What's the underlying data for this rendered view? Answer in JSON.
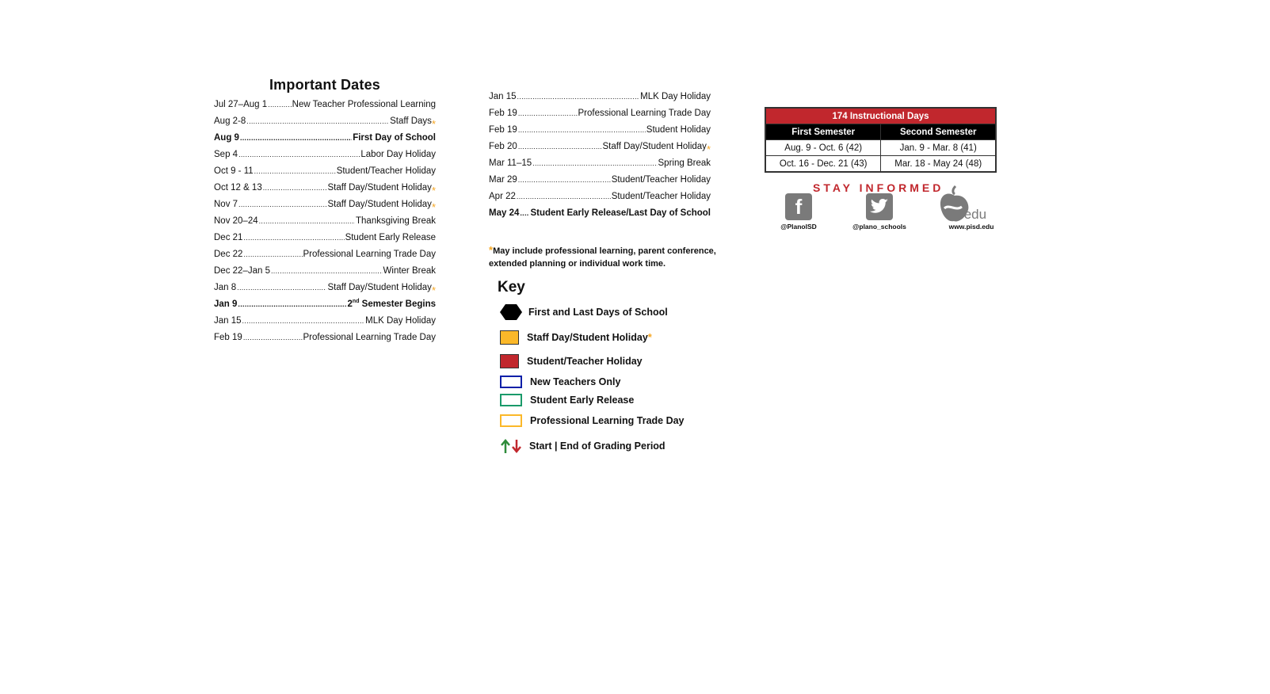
{
  "important_dates": {
    "title": "Important Dates",
    "col1": [
      {
        "date": "Jul 27–Aug 1",
        "event": "New Teacher Professional Learning",
        "bold": false,
        "asterisk": false
      },
      {
        "date": "Aug 2-8",
        "event": "Staff Days",
        "bold": false,
        "asterisk": true
      },
      {
        "date": "Aug 9",
        "event": "First Day of School",
        "bold": true,
        "asterisk": false
      },
      {
        "date": "Sep 4",
        "event": "Labor Day Holiday",
        "bold": false,
        "asterisk": false
      },
      {
        "date": "Oct 9 - 11",
        "event": "Student/Teacher Holiday",
        "bold": false,
        "asterisk": false
      },
      {
        "date": "Oct 12 & 13",
        "event": "Staff Day/Student Holiday",
        "bold": false,
        "asterisk": true
      },
      {
        "date": "Nov 7",
        "event": "Staff Day/Student Holiday",
        "bold": false,
        "asterisk": true
      },
      {
        "date": "Nov 20–24",
        "event": "Thanksgiving Break",
        "bold": false,
        "asterisk": false
      },
      {
        "date": "Dec 21",
        "event": "Student Early Release",
        "bold": false,
        "asterisk": false
      },
      {
        "date": "Dec 22",
        "event": "Professional Learning Trade Day",
        "bold": false,
        "asterisk": false
      },
      {
        "date": "Dec 22–Jan 5",
        "event": "Winter Break",
        "bold": false,
        "asterisk": false
      },
      {
        "date": "Jan 8",
        "event": "Staff Day/Student Holiday",
        "bold": false,
        "asterisk": true
      },
      {
        "date": "Jan 9",
        "event": "2nd Semester Begins",
        "bold": true,
        "asterisk": false
      },
      {
        "date": "Jan 15",
        "event": "MLK Day Holiday",
        "bold": false,
        "asterisk": false
      },
      {
        "date": "Feb 19",
        "event": "Professional Learning Trade Day",
        "bold": false,
        "asterisk": false
      }
    ],
    "col2": [
      {
        "date": "Jan 15",
        "event": "MLK Day Holiday",
        "bold": false,
        "asterisk": false
      },
      {
        "date": "Feb 19",
        "event": "Professional Learning Trade Day",
        "bold": false,
        "asterisk": false
      },
      {
        "date": "Feb 19",
        "event": "Student Holiday",
        "bold": false,
        "asterisk": false
      },
      {
        "date": "Feb 20",
        "event": "Staff Day/Student Holiday",
        "bold": false,
        "asterisk": true
      },
      {
        "date": "Mar 11–15",
        "event": "Spring Break",
        "bold": false,
        "asterisk": false
      },
      {
        "date": "Mar 29",
        "event": "Student/Teacher Holiday",
        "bold": false,
        "asterisk": false
      },
      {
        "date": "Apr 22",
        "event": "Student/Teacher Holiday",
        "bold": false,
        "asterisk": false
      },
      {
        "date": "May 24",
        "event": "Student Early Release/Last Day of School",
        "bold": true,
        "asterisk": false
      }
    ]
  },
  "note": {
    "asterisk": "*",
    "line1": "May include professional learning, parent conference,",
    "line2": "extended planning or individual work time."
  },
  "key": {
    "title": "Key",
    "items": [
      {
        "label": "First and Last Days of School",
        "type": "hexagon",
        "color": "#000000"
      },
      {
        "label": "Staff Day/Student Holiday",
        "type": "filled",
        "color": "#fbb829",
        "asterisk": "*"
      },
      {
        "label": "Student/Teacher Holiday",
        "type": "filled",
        "color": "#c1272d"
      },
      {
        "label": "New Teachers Only",
        "type": "outline",
        "color": "#0a1fa8"
      },
      {
        "label": "Student Early Release",
        "type": "outline",
        "color": "#1a9a6a"
      },
      {
        "label": "Professional Learning Trade Day",
        "type": "outline",
        "color": "#fbb829"
      },
      {
        "label": "Start | End of Grading Period",
        "type": "arrows",
        "colors": [
          "#2e8b3a",
          "#c1272d"
        ]
      }
    ]
  },
  "instructional_days": {
    "title": "174 Instructional Days",
    "headers": [
      "First Semester",
      "Second Semester"
    ],
    "rows": [
      [
        "Aug. 9 - Oct. 6 (42)",
        "Jan. 9 - Mar. 8 (41)"
      ],
      [
        "Oct. 16 - Dec. 21 (43)",
        "Mar. 18 - May 24 (48)"
      ]
    ]
  },
  "stay_informed": {
    "title": "STAY INFORMED",
    "facebook": "@PlanoISD",
    "twitter": "@plano_schools",
    "website": "www.pisd.edu",
    "edu": ".edu"
  },
  "colors": {
    "accent_red": "#c1272d",
    "asterisk": "#f5a623",
    "icon_gray": "#7a7a7a"
  }
}
